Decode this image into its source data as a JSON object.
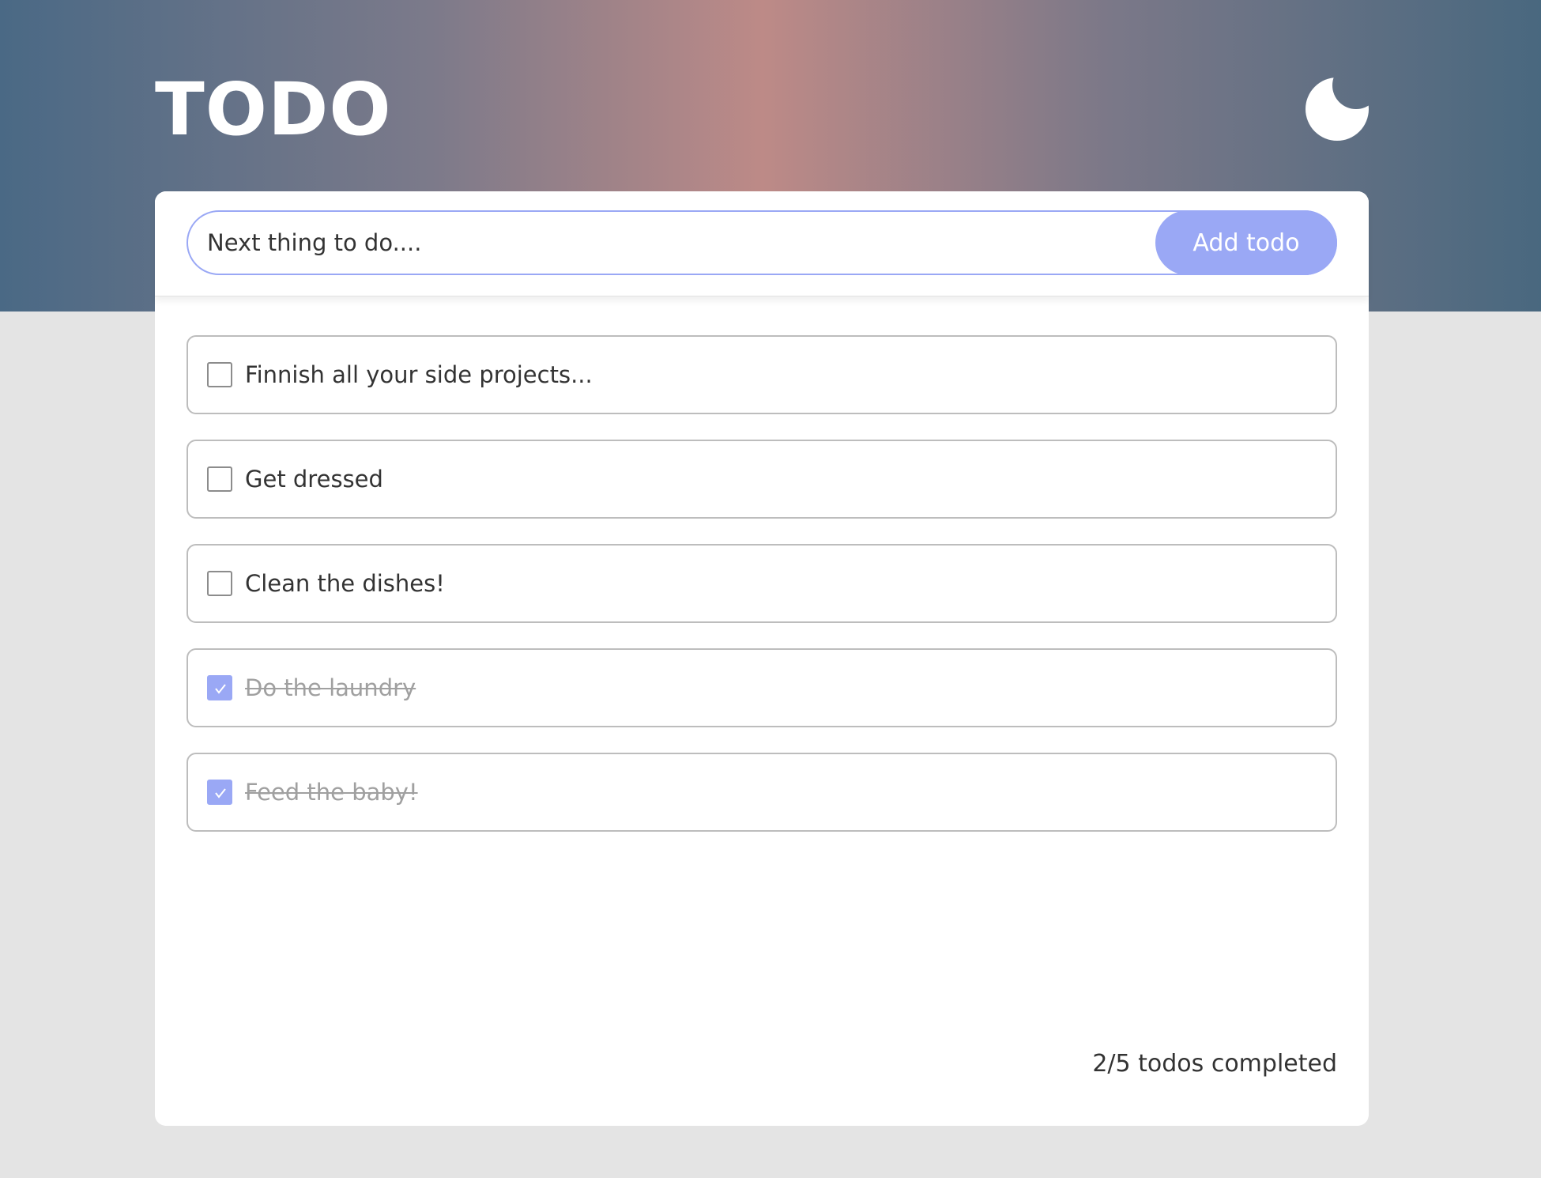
{
  "header": {
    "title": "TODO",
    "theme_icon": "moon-icon"
  },
  "new_todo": {
    "placeholder": "Next thing to do....",
    "value": "",
    "add_label": "Add todo"
  },
  "todos": [
    {
      "text": "Finnish all your side projects...",
      "completed": false
    },
    {
      "text": "Get dressed",
      "completed": false
    },
    {
      "text": "Clean the dishes!",
      "completed": false
    },
    {
      "text": "Do the laundry",
      "completed": true
    },
    {
      "text": "Feed the baby!",
      "completed": true
    }
  ],
  "footer": {
    "status": "2/5 todos completed"
  },
  "colors": {
    "accent": "#9aa8f5",
    "header_left": "#4a6985",
    "header_center": "#bd8a87",
    "page_background": "#e4e4e4",
    "text": "#333333",
    "done_text": "#a0a0a0"
  }
}
